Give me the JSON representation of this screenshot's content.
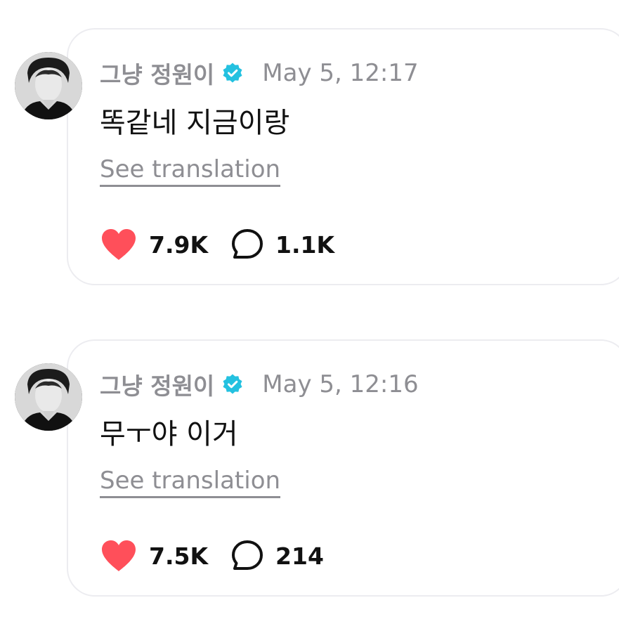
{
  "posts": [
    {
      "username": "그냥 정원이",
      "timestamp": "May 5, 12:17",
      "message": "똑같네 지금이랑",
      "translate_label": "See translation",
      "likes": "7.9K",
      "replies": "1.1K"
    },
    {
      "username": "그냥 정원이",
      "timestamp": "May 5, 12:16",
      "message": "무ㅜ야 이거",
      "translate_label": "See translation",
      "likes": "7.5K",
      "replies": "214"
    }
  ],
  "colors": {
    "heart": "#ff4f5a",
    "verified": "#24c1e0",
    "muted_text": "#8e8e93",
    "bubble_border": "#ececf0"
  },
  "icons": {
    "verified": "verified-badge-icon",
    "like": "heart-icon",
    "reply": "speech-bubble-icon"
  }
}
